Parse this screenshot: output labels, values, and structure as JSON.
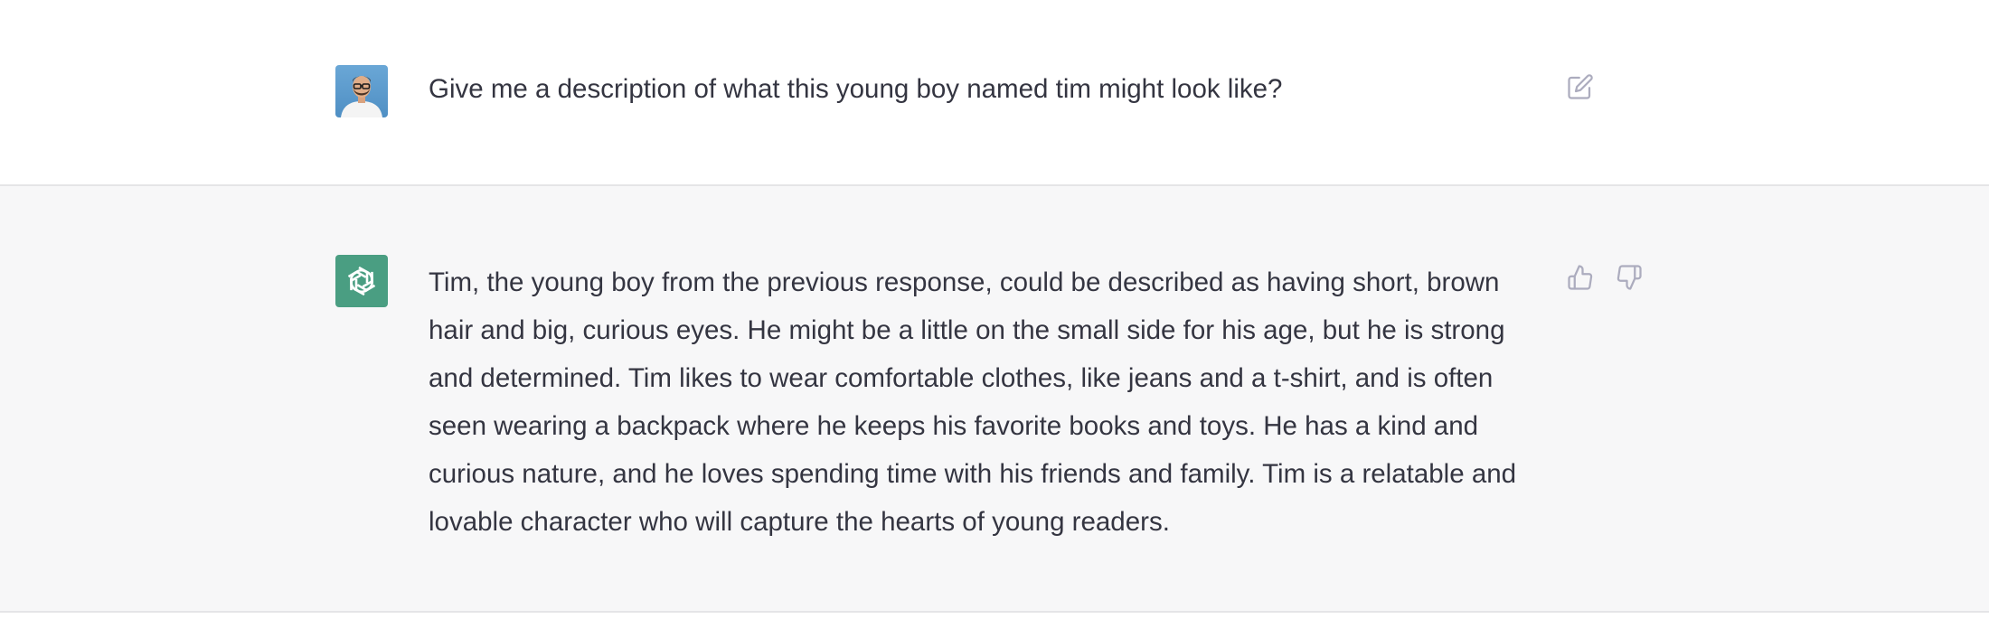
{
  "conversation": {
    "user_message": {
      "text": "Give me a description of what this young boy named tim might look like?",
      "avatar_icon": "user-avatar-photo",
      "edit_icon": "edit-icon"
    },
    "assistant_message": {
      "text": "Tim, the young boy from the previous response, could be described as having short, brown hair and big, curious eyes. He might be a little on the small side for his age, but he is strong and determined. Tim likes to wear comfortable clothes, like jeans and a t-shirt, and is often seen wearing a backpack where he keeps his favorite books and toys. He has a kind and curious nature, and he loves spending time with his friends and family. Tim is a relatable and lovable character who will capture the hearts of young readers.",
      "avatar_icon": "openai-logo-icon",
      "feedback_icons": [
        "thumbs-up-icon",
        "thumbs-down-icon"
      ]
    }
  },
  "colors": {
    "assistant_bg": "#f7f7f8",
    "bot_avatar_bg": "#4a9e82",
    "text": "#343541",
    "icon": "#acacbe"
  }
}
